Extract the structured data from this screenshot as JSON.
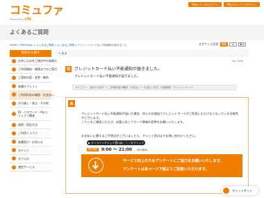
{
  "header": {
    "logo": "コミュファ",
    "logo_sub": "Powered by",
    "logo_brand": "ctc",
    "links": [
      "Web メールログイン",
      "Myコミュファログイン"
    ]
  },
  "page": {
    "title": "よくあるご質問"
  },
  "breadcrumb": {
    "home": "HOME",
    "trail": "> PERSONAL > よくあるご質問 > よくあるご質問 > ",
    "current": "クレジットカード払い不能通知が届きました。"
  },
  "font_size": {
    "label": "文字サイズ変更",
    "options": [
      "標準",
      "大",
      "最大"
    ],
    "selected": "標準"
  },
  "sidebar": {
    "heading": "目的から探す",
    "items": [
      "お申し込みをご検討中の皆様方",
      "ご利用開始・開通までのご案内",
      "ご契約内容・変更・解約",
      "各種オプション",
      "ご利用料金の確認・お支払い",
      "お引越し・休止・その他",
      "ID・パスワード・Myコミュファ関連",
      "接続・設定方法",
      "ご利用トラブル",
      "各種窓口・お知らせ",
      "光テレビ",
      "光でんわ",
      "運営サービス"
    ]
  },
  "question": {
    "back": "戻る",
    "number": "No. 3292",
    "badge": "Q",
    "title": "クレジットカード払い不能通知が届きました。",
    "subtitle": "クレジットカード払い不能通知が届きました。",
    "category": "カテゴリー：目的から探す ＞ ご利用料金の確認・お支払い ＞ お支払い方法（口座振替・クレジットカード）"
  },
  "answer": {
    "badge": "A",
    "body": "クレジットカード払い不能通知が届いた場合、何らかの理由でクレジットカードがご利用いただけなくなっている可能性がございます。",
    "link": "こちら",
    "body2": "をご確認いただき、必要に応じてカード情報の変更をお願いいたします。",
    "note": "お支払いに関するご不明点がございましたら、チャット窓口までお問い合わせください。",
    "chat_prefix": "オンラインチャット窓口は",
    "chat_link": "こちら",
    "chat_suffix": "をクリック",
    "hours_label": "受付時間",
    "hours": "9:00 ～ 21:00",
    "hours_note": "（年中無休）"
  },
  "survey": {
    "line1": "サービス向上のためアンケートにご協力をお願いいたします。",
    "line2": "アンケートは本ページ下部よりご回答いただけます。"
  },
  "chatbot": {
    "label": "チャットボット"
  },
  "colors": {
    "accent": "#ef7d00",
    "link": "#1a5fb4"
  }
}
